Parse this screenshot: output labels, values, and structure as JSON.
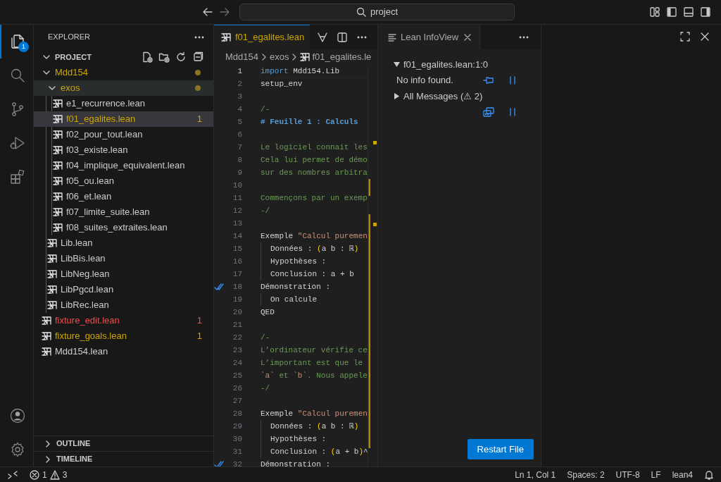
{
  "title_bar": {
    "search": "project"
  },
  "activity_bar": {
    "items": [
      {
        "kind": "explorer",
        "selected": true,
        "badge": "1"
      },
      {
        "kind": "search",
        "selected": false
      },
      {
        "kind": "source-control",
        "selected": false
      },
      {
        "kind": "run-debug",
        "selected": false
      },
      {
        "kind": "extensions",
        "selected": false
      }
    ],
    "bottom": [
      {
        "kind": "account"
      },
      {
        "kind": "settings"
      }
    ]
  },
  "sidebar": {
    "title": "EXPLORER",
    "section": {
      "label": "PROJECT",
      "expanded": true
    },
    "tree": [
      {
        "label": "Mdd154",
        "kind": "folder",
        "expanded": true,
        "warning": true,
        "error": false,
        "dot": true,
        "selected": false,
        "hovered": false,
        "children": [
          {
            "label": "exos",
            "kind": "folder",
            "expanded": true,
            "warning": true,
            "error": false,
            "dot": true,
            "selected": false,
            "hovered": true,
            "children": [
              {
                "label": "e1_recurrence.lean",
                "kind": "file",
                "warning": false,
                "error": false,
                "dot": false,
                "selected": false,
                "hovered": false
              },
              {
                "label": "f01_egalites.lean",
                "kind": "file",
                "warning": true,
                "error": false,
                "badge": "1",
                "dot": false,
                "selected": true,
                "hovered": false
              },
              {
                "label": "f02_pour_tout.lean",
                "kind": "file",
                "warning": false,
                "error": false,
                "dot": false,
                "selected": false,
                "hovered": false
              },
              {
                "label": "f03_existe.lean",
                "kind": "file",
                "warning": false,
                "error": false,
                "dot": false,
                "selected": false,
                "hovered": false
              },
              {
                "label": "f04_implique_equivalent.lean",
                "kind": "file",
                "warning": false,
                "error": false,
                "dot": false,
                "selected": false,
                "hovered": false
              },
              {
                "label": "f05_ou.lean",
                "kind": "file",
                "warning": false,
                "error": false,
                "dot": false,
                "selected": false,
                "hovered": false
              },
              {
                "label": "f06_et.lean",
                "kind": "file",
                "warning": false,
                "error": false,
                "dot": false,
                "selected": false,
                "hovered": false
              },
              {
                "label": "f07_limite_suite.lean",
                "kind": "file",
                "warning": false,
                "error": false,
                "dot": false,
                "selected": false,
                "hovered": false
              },
              {
                "label": "f08_suites_extraites.lean",
                "kind": "file",
                "warning": false,
                "error": false,
                "dot": false,
                "selected": false,
                "hovered": false
              }
            ]
          },
          {
            "label": "Lib.lean",
            "kind": "file",
            "warning": false,
            "error": false,
            "dot": false,
            "selected": false,
            "hovered": false
          },
          {
            "label": "LibBis.lean",
            "kind": "file",
            "warning": false,
            "error": false,
            "dot": false,
            "selected": false,
            "hovered": false
          },
          {
            "label": "LibNeg.lean",
            "kind": "file",
            "warning": false,
            "error": false,
            "dot": false,
            "selected": false,
            "hovered": false
          },
          {
            "label": "LibPgcd.lean",
            "kind": "file",
            "warning": false,
            "error": false,
            "dot": false,
            "selected": false,
            "hovered": false
          },
          {
            "label": "LibRec.lean",
            "kind": "file",
            "warning": false,
            "error": false,
            "dot": false,
            "selected": false,
            "hovered": false
          }
        ]
      },
      {
        "label": "fixture_edit.lean",
        "kind": "file",
        "warning": false,
        "error": true,
        "badge": "1",
        "dot": false,
        "selected": false,
        "hovered": false
      },
      {
        "label": "fixture_goals.lean",
        "kind": "file",
        "warning": true,
        "error": false,
        "badge": "1",
        "dot": false,
        "selected": false,
        "hovered": false
      },
      {
        "label": "Mdd154.lean",
        "kind": "file",
        "warning": false,
        "error": false,
        "dot": false,
        "selected": false,
        "hovered": false
      }
    ],
    "panels": [
      {
        "label": "OUTLINE",
        "expanded": false
      },
      {
        "label": "TIMELINE",
        "expanded": false
      }
    ]
  },
  "editor": {
    "tab": {
      "label": "f01_egalites.lean",
      "warning": true,
      "selected": true
    },
    "breadcrumbs": [
      "Mdd154",
      "exos",
      "f01_egalites.le"
    ],
    "lines": [
      {
        "number": "1",
        "current": true,
        "check": false,
        "guide": false,
        "tokens": [
          {
            "kind": "keyword",
            "text": "import"
          },
          {
            "kind": "plain",
            "text": " Mdd154.Lib"
          }
        ]
      },
      {
        "number": "2",
        "current": false,
        "check": false,
        "guide": false,
        "tokens": [
          {
            "kind": "plain",
            "text": "setup_env"
          }
        ]
      },
      {
        "number": "3",
        "current": false,
        "check": false,
        "guide": false
      },
      {
        "number": "4",
        "current": false,
        "check": false,
        "guide": false,
        "tokens": [
          {
            "kind": "comment",
            "text": "/-"
          }
        ]
      },
      {
        "number": "5",
        "current": false,
        "check": false,
        "guide": false,
        "tokens": [
          {
            "kind": "heading",
            "text": "# Feuille 1 : Calculs"
          }
        ]
      },
      {
        "number": "6",
        "current": false,
        "check": false,
        "guide": false
      },
      {
        "number": "7",
        "current": false,
        "check": false,
        "guide": false,
        "tokens": [
          {
            "kind": "comment",
            "text": "Le logiciel connait les"
          }
        ]
      },
      {
        "number": "8",
        "current": false,
        "check": false,
        "guide": false,
        "tokens": [
          {
            "kind": "comment",
            "text": "Cela lui permet de démo"
          }
        ]
      },
      {
        "number": "9",
        "current": false,
        "check": false,
        "guide": false,
        "tokens": [
          {
            "kind": "comment",
            "text": "sur des nombres arbitra"
          }
        ]
      },
      {
        "number": "10",
        "current": false,
        "check": false,
        "guide": false
      },
      {
        "number": "11",
        "current": false,
        "check": false,
        "guide": false,
        "tokens": [
          {
            "kind": "comment",
            "text": "Commençons par un exemp"
          }
        ]
      },
      {
        "number": "12",
        "current": false,
        "check": false,
        "guide": false,
        "tokens": [
          {
            "kind": "comment",
            "text": "-/"
          }
        ]
      },
      {
        "number": "13",
        "current": false,
        "check": false,
        "guide": false
      },
      {
        "number": "14",
        "current": false,
        "check": false,
        "guide": false,
        "tokens": [
          {
            "kind": "plain",
            "text": "Exemple "
          },
          {
            "kind": "string",
            "text": "\"Calcul puremen"
          }
        ]
      },
      {
        "number": "15",
        "current": false,
        "check": false,
        "guide": true,
        "tokens": [
          {
            "kind": "plain",
            "text": "Données : "
          },
          {
            "kind": "bracket",
            "text": "("
          },
          {
            "kind": "plain",
            "text": "a b : ℝ"
          },
          {
            "kind": "bracket",
            "text": ")"
          }
        ]
      },
      {
        "number": "16",
        "current": false,
        "check": false,
        "guide": true,
        "tokens": [
          {
            "kind": "plain",
            "text": "Hypothèses :"
          }
        ]
      },
      {
        "number": "17",
        "current": false,
        "check": false,
        "guide": true,
        "tokens": [
          {
            "kind": "plain",
            "text": "Conclusion : a + b"
          }
        ]
      },
      {
        "number": "18",
        "current": false,
        "check": true,
        "guide": false,
        "tokens": [
          {
            "kind": "plain",
            "text": "Démonstration :"
          }
        ]
      },
      {
        "number": "19",
        "current": false,
        "check": false,
        "guide": true,
        "tokens": [
          {
            "kind": "plain",
            "text": "On calcule"
          }
        ]
      },
      {
        "number": "20",
        "current": false,
        "check": false,
        "guide": false,
        "tokens": [
          {
            "kind": "plain",
            "text": "QED"
          }
        ]
      },
      {
        "number": "21",
        "current": false,
        "check": false,
        "guide": false
      },
      {
        "number": "22",
        "current": false,
        "check": false,
        "guide": false,
        "tokens": [
          {
            "kind": "comment",
            "text": "/-"
          }
        ]
      },
      {
        "number": "23",
        "current": false,
        "check": false,
        "guide": false,
        "tokens": [
          {
            "kind": "comment",
            "text": "L’ordinateur vérifie ce"
          }
        ]
      },
      {
        "number": "24",
        "current": false,
        "check": false,
        "guide": false,
        "tokens": [
          {
            "kind": "comment",
            "text": "L’important est que le"
          }
        ]
      },
      {
        "number": "25",
        "current": false,
        "check": false,
        "guide": false,
        "tokens": [
          {
            "kind": "string",
            "text": "`a`"
          },
          {
            "kind": "comment",
            "text": " et "
          },
          {
            "kind": "string",
            "text": "`b`"
          },
          {
            "kind": "comment",
            "text": ". Nous appele"
          }
        ]
      },
      {
        "number": "26",
        "current": false,
        "check": false,
        "guide": false,
        "tokens": [
          {
            "kind": "comment",
            "text": "-/"
          }
        ]
      },
      {
        "number": "27",
        "current": false,
        "check": false,
        "guide": false
      },
      {
        "number": "28",
        "current": false,
        "check": false,
        "guide": false,
        "tokens": [
          {
            "kind": "plain",
            "text": "Exemple "
          },
          {
            "kind": "string",
            "text": "\"Calcul puremen"
          }
        ]
      },
      {
        "number": "29",
        "current": false,
        "check": false,
        "guide": true,
        "tokens": [
          {
            "kind": "plain",
            "text": "Données : "
          },
          {
            "kind": "bracket",
            "text": "("
          },
          {
            "kind": "plain",
            "text": "a b : ℝ"
          },
          {
            "kind": "bracket",
            "text": ")"
          }
        ]
      },
      {
        "number": "30",
        "current": false,
        "check": false,
        "guide": true,
        "tokens": [
          {
            "kind": "plain",
            "text": "Hypothèses :"
          }
        ]
      },
      {
        "number": "31",
        "current": false,
        "check": false,
        "guide": true,
        "tokens": [
          {
            "kind": "plain",
            "text": "Conclusion : "
          },
          {
            "kind": "bracket",
            "text": "("
          },
          {
            "kind": "plain",
            "text": "a + b"
          },
          {
            "kind": "bracket",
            "text": ")"
          },
          {
            "kind": "plain",
            "text": "^"
          }
        ]
      },
      {
        "number": "32",
        "current": false,
        "check": true,
        "guide": false,
        "tokens": [
          {
            "kind": "plain",
            "text": "Démonstration :"
          }
        ]
      }
    ]
  },
  "infoview": {
    "tab": "Lean InfoView",
    "sections": [
      {
        "label": "f01_egalites.lean:1:0",
        "expanded": true,
        "body": "No info found."
      },
      {
        "label": "All Messages (⚠ 2)",
        "expanded": false
      }
    ],
    "button": "Restart File"
  },
  "status_bar": {
    "errors": "1",
    "warnings": "3",
    "items": [
      "Ln 1, Col 1",
      "Spaces: 2",
      "UTF-8",
      "LF",
      "lean4"
    ]
  }
}
